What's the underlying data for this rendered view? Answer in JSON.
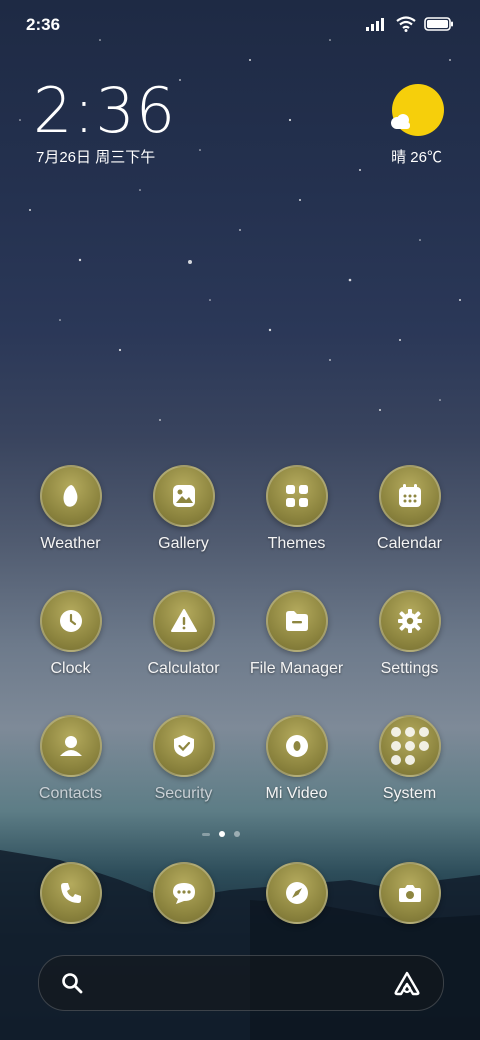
{
  "status": {
    "time": "2:36"
  },
  "widget": {
    "clock": "2:36",
    "date": "7月26日 周三下午",
    "weather": "晴 26℃"
  },
  "apps": [
    {
      "label": "Weather",
      "icon": "weather-icon"
    },
    {
      "label": "Gallery",
      "icon": "gallery-icon"
    },
    {
      "label": "Themes",
      "icon": "themes-icon"
    },
    {
      "label": "Calendar",
      "icon": "calendar-icon"
    },
    {
      "label": "Clock",
      "icon": "clock-icon"
    },
    {
      "label": "Calculator",
      "icon": "calculator-icon"
    },
    {
      "label": "File Manager",
      "icon": "file-manager-icon"
    },
    {
      "label": "Settings",
      "icon": "settings-icon"
    },
    {
      "label": "Contacts",
      "icon": "contacts-icon"
    },
    {
      "label": "Security",
      "icon": "security-icon"
    },
    {
      "label": "Mi Video",
      "icon": "mi-video-icon"
    },
    {
      "label": "System",
      "icon": "folder-icon"
    }
  ],
  "dock": [
    {
      "icon": "phone-icon"
    },
    {
      "icon": "messages-icon"
    },
    {
      "icon": "browser-icon"
    },
    {
      "icon": "camera-icon"
    }
  ],
  "colors": {
    "icon_bg": "#8e8640",
    "sun": "#f6cf0b"
  }
}
